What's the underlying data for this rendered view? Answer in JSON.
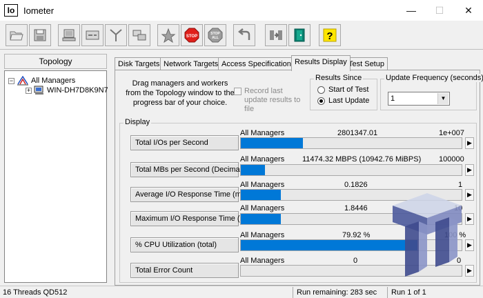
{
  "window": {
    "title": "Iometer",
    "app_icon_text": "Io"
  },
  "topology": {
    "header": "Topology",
    "root_label": "All Managers",
    "child_label": "WIN-DH7D8K9N7",
    "root_expander": "−",
    "child_expander": "+"
  },
  "tabs": [
    {
      "label": "Disk Targets"
    },
    {
      "label": "Network Targets"
    },
    {
      "label": "Access Specifications"
    },
    {
      "label": "Results Display"
    },
    {
      "label": "Test Setup"
    }
  ],
  "instruction": "Drag managers and workers from the Topology window to the progress bar of your choice.",
  "record_option": {
    "label": "Record last update results to file",
    "checked": false
  },
  "results_since": {
    "title": "Results Since",
    "options": [
      {
        "label": "Start of Test",
        "selected": false
      },
      {
        "label": "Last Update",
        "selected": true
      }
    ]
  },
  "update_frequency": {
    "title": "Update Frequency (seconds)",
    "value": "1"
  },
  "display": {
    "title": "Display",
    "metrics": [
      {
        "button": "Total I/Os per Second",
        "source": "All Managers",
        "value": "2801347.01",
        "scale": "1e+007",
        "fill": 0.28
      },
      {
        "button": "Total MBs per Second (Decimal)",
        "source": "All Managers",
        "value": "11474.32 MBPS (10942.76 MiBPS)",
        "scale": "100000",
        "fill": 0.11
      },
      {
        "button": "Average I/O Response Time (ms)",
        "source": "All Managers",
        "value": "0.1826",
        "scale": "1",
        "fill": 0.18
      },
      {
        "button": "Maximum I/O Response Time (ms)",
        "source": "All Managers",
        "value": "1.8446",
        "scale": "10",
        "fill": 0.18
      },
      {
        "button": "% CPU Utilization (total)",
        "source": "All Managers",
        "value": "79.92 %",
        "scale": "100 %",
        "fill": 0.8
      },
      {
        "button": "Total Error Count",
        "source": "All Managers",
        "value": "0",
        "scale": "0",
        "fill": 0
      }
    ]
  },
  "status": {
    "config": "16 Threads QD512",
    "remaining": "Run remaining: 283 sec",
    "run": "Run 1 of 1"
  },
  "colors": {
    "bar_fill": "#0078d7",
    "stop_red": "#e0201b",
    "help_yellow": "#ffe600"
  },
  "toolbar_icons": [
    "open-config-icon",
    "save-config-icon",
    "new-disk-worker-icon",
    "new-network-worker-icon",
    "duplicate-worker-icon",
    "disconnect-icon",
    "start-test-icon",
    "stop-icon",
    "stop-all-icon",
    "reset-workers-icon",
    "exit-icon",
    "help-icon"
  ],
  "window_controls": {
    "minimize": "—",
    "maximize": "☐",
    "close": "✕"
  }
}
